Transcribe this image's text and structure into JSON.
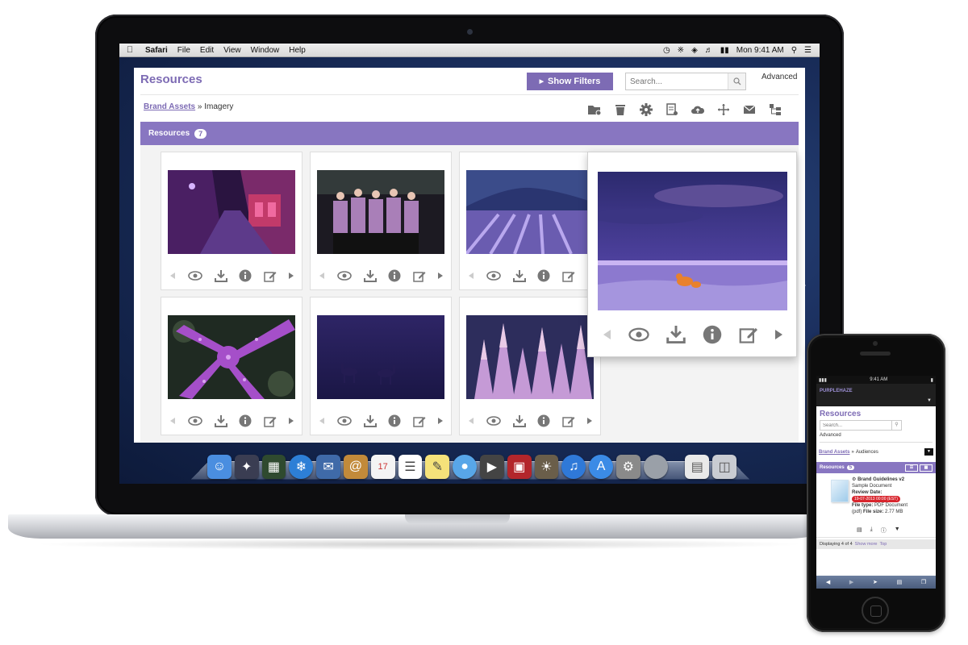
{
  "menubar": {
    "app_name": "Safari",
    "menus": [
      "File",
      "Edit",
      "View",
      "Window",
      "Help"
    ],
    "clock": "Mon 9:41 AM"
  },
  "header": {
    "title": "Resources",
    "show_filters_label": "Show Filters",
    "search_placeholder": "Search...",
    "advanced_label": "Advanced"
  },
  "breadcrumb": {
    "parent": "Brand Assets",
    "separator": "»",
    "current": "Imagery"
  },
  "toolbar": {
    "icons": [
      "new-folder-icon",
      "trash-icon",
      "gear-icon",
      "report-icon",
      "cloud-upload-icon",
      "move-icon",
      "mail-icon",
      "hierarchy-icon"
    ]
  },
  "resources_bar": {
    "label": "Resources",
    "count": "7"
  },
  "cards": [
    {
      "image": "purple-alley-photo"
    },
    {
      "image": "dancers-group-photo"
    },
    {
      "image": "lavender-field-photo"
    },
    {
      "image": "starfish-photo"
    },
    {
      "image": "deer-in-fog-photo"
    },
    {
      "image": "snowy-trees-photo"
    }
  ],
  "card_actions": [
    "prev-icon",
    "eye-icon",
    "download-icon",
    "info-icon",
    "edit-icon",
    "next-icon"
  ],
  "popup": {
    "image": "polar-bear-sunset-photo"
  },
  "colors": {
    "brand": "#7d6bb4",
    "bar": "#8876c1",
    "date_badge": "#d8262e"
  },
  "phone": {
    "status_time": "9:41 AM",
    "brand_text": "PURPLEHAZE",
    "title": "Resources",
    "search_placeholder": "Search...",
    "advanced_label": "Advanced",
    "breadcrumb_parent": "Brand Assets",
    "breadcrumb_separator": "»",
    "breadcrumb_current": "Audiences",
    "resources_label": "Resources",
    "resources_count": "5",
    "item": {
      "name": "Brand Guidelines v2",
      "subtitle": "Sample Document",
      "review_label": "Review Date:",
      "review_date": "19-07-2013 00:00 (EST)",
      "file_type_label": "File type:",
      "file_type": "PDF Document",
      "ext": "(pdf)",
      "file_size_label": "File size:",
      "file_size": "2.77 MB"
    },
    "footer_display": "Displaying 4 of 4",
    "footer_show_more": "Show more",
    "footer_top": "Top"
  }
}
